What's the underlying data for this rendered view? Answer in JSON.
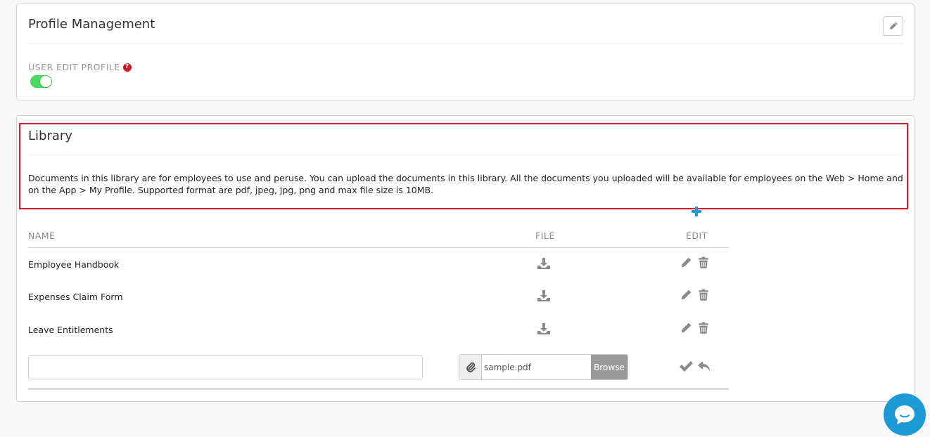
{
  "profile_card": {
    "title": "Profile Management",
    "field_label": "USER EDIT PROFILE",
    "toggle_on": true
  },
  "library_card": {
    "title": "Library",
    "description": "Documents in this library are for employees to use and peruse. You can upload the documents in this library. All the documents you uploaded will be available for employees on the Web > Home and on the App > My Profile. Supported format are pdf, jpeg, jpg, png and max file size is 10MB.",
    "columns": {
      "name": "NAME",
      "file": "FILE",
      "edit": "EDIT"
    },
    "rows": [
      {
        "name": "Employee Handbook"
      },
      {
        "name": "Expenses Claim Form"
      },
      {
        "name": "Leave Entitlements"
      }
    ],
    "new_row": {
      "name_value": "",
      "file_name": "sample.pdf",
      "browse_label": "Browse"
    }
  },
  "colors": {
    "accent": "#1c9ad6",
    "toggle_on": "#4cd964",
    "highlight": "#d9192c",
    "help_icon": "#d3182b"
  },
  "icons": [
    "pencil-icon",
    "help-icon",
    "plus-icon",
    "download-icon",
    "trash-icon",
    "paperclip-icon",
    "check-icon",
    "undo-icon",
    "chat-icon"
  ]
}
